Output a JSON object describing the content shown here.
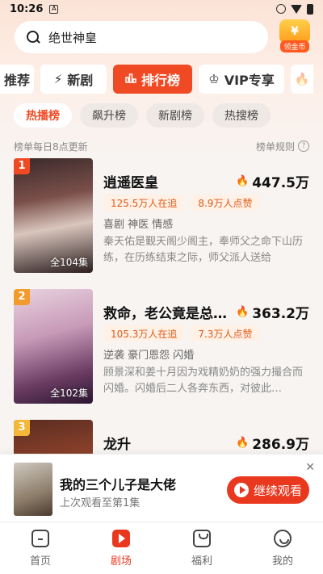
{
  "status_bar": {
    "time": "10:26"
  },
  "search": {
    "query": "绝世神皇"
  },
  "coin": {
    "label": "领金币",
    "symbol": "¥"
  },
  "tabs": [
    {
      "label": "推荐",
      "icon": "",
      "active": false
    },
    {
      "label": "新剧",
      "icon": "⚡",
      "active": false
    },
    {
      "label": "排行榜",
      "icon": "📊",
      "active": true
    },
    {
      "label": "VIP专享",
      "icon": "♔",
      "active": false
    },
    {
      "label": "",
      "icon": "🔥",
      "active": false
    }
  ],
  "sub_tabs": [
    {
      "label": "热播榜",
      "active": true
    },
    {
      "label": "飙升榜",
      "active": false
    },
    {
      "label": "新剧榜",
      "active": false
    },
    {
      "label": "热搜榜",
      "active": false
    }
  ],
  "info": {
    "update_note": "榜单每日8点更新",
    "rules_label": "榜单规则"
  },
  "dramas": [
    {
      "rank": "1",
      "rank_color": "#ef4a24",
      "title": "逍遥医皇",
      "heat": "447.5万",
      "tag1": "125.5万人在追",
      "tag2": "8.9万人点赞",
      "genre": "喜剧 神医 情感",
      "desc": "秦天佑是觐天阁少阁主，奉师父之命下山历练，在历练结束之际，师父派人送给",
      "episodes": "全104集"
    },
    {
      "rank": "2",
      "rank_color": "#f29a2c",
      "title": "救命，老公竟是总…",
      "heat": "363.2万",
      "tag1": "105.3万人在追",
      "tag2": "7.3万人点赞",
      "genre": "逆袭 豪门恩怨 闪婚",
      "desc": "顾景深和姜十月因为戏精奶奶的强力撮合而闪婚。闪婚后二人各奔东西，对彼此…",
      "episodes": "全102集"
    },
    {
      "rank": "3",
      "rank_color": "#f4b73a",
      "title": "龙升",
      "heat": "286.9万",
      "tag1": "",
      "tag2": "",
      "genre": "",
      "desc": "",
      "episodes": ""
    }
  ],
  "continue_watching": {
    "title": "我的三个儿子是大佬",
    "subtitle": "上次观看至第1集",
    "button": "继续观看"
  },
  "bottom_nav": [
    {
      "label": "首页",
      "icon": "home-icon",
      "active": false
    },
    {
      "label": "剧场",
      "icon": "theater-icon",
      "active": true
    },
    {
      "label": "福利",
      "icon": "gift-icon",
      "active": false
    },
    {
      "label": "我的",
      "icon": "profile-icon",
      "active": false
    }
  ]
}
